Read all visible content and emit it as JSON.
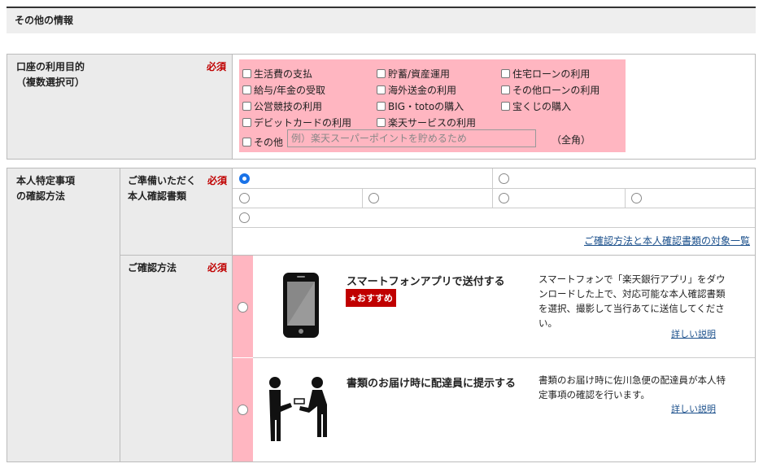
{
  "section": {
    "title": "その他の情報"
  },
  "purpose": {
    "label_line1": "口座の利用目的",
    "label_line2": "（複数選択可）",
    "required": "必須",
    "options": [
      "生活費の支払",
      "貯蓄/資産運用",
      "住宅ローンの利用",
      "給与/年金の受取",
      "海外送金の利用",
      "その他ローンの利用",
      "公営競技の利用",
      "BIG・totoの購入",
      "宝くじの購入",
      "デビットカードの利用",
      "楽天サービスの利用"
    ],
    "other_label": "その他",
    "other_placeholder": "例）楽天スーパーポイントを貯めるため",
    "other_note": "（全角）"
  },
  "identity": {
    "label_line1": "本人特定事項",
    "label_line2": "の確認方法",
    "documents": {
      "label_line1": "ご準備いただく",
      "label_line2": "本人確認書類",
      "required": "必須",
      "link": "ご確認方法と本人確認書類の対象一覧"
    },
    "method": {
      "label": "ご確認方法",
      "required": "必須",
      "options": [
        {
          "title": "スマートフォンアプリで送付する",
          "badge": "★おすすめ",
          "desc": "スマートフォンで「楽天銀行アプリ」をダウンロードした上で、対応可能な本人確認書類を選択、撮影して当行あてに送信してください。",
          "link": "詳しい説明",
          "icon": "smartphone-icon"
        },
        {
          "title": "書類のお届け時に配達員に提示する",
          "desc": "書類のお届け時に佐川急便の配達員が本人特定事項の確認を行います。",
          "link": "詳しい説明",
          "icon": "delivery-handover-icon"
        }
      ]
    }
  },
  "colors": {
    "pink": "#ffb6c1",
    "required": "#c00000",
    "link": "#1a4f8b",
    "label_bg": "#ebebeb"
  }
}
